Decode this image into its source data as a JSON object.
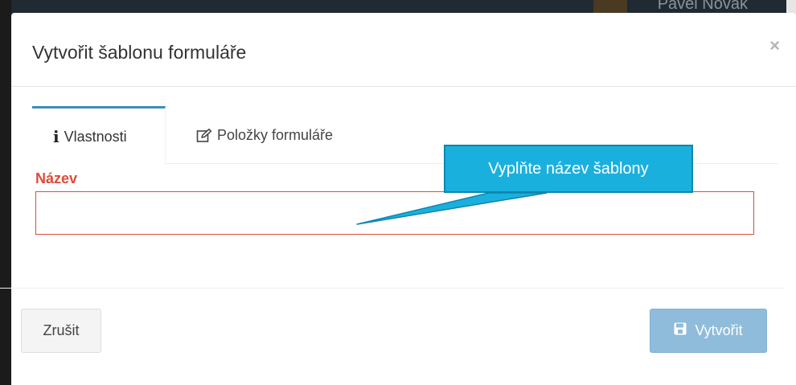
{
  "backdrop": {
    "user_name": "Pavel Novák"
  },
  "modal": {
    "title": "Vytvořit šablonu formuláře",
    "close_label": "×"
  },
  "tabs": [
    {
      "label": "Vlastnosti",
      "icon": "info-icon",
      "active": true
    },
    {
      "label": "Položky formuláře",
      "icon": "edit-icon",
      "active": false
    }
  ],
  "form": {
    "name_label": "Název",
    "name_value": "",
    "error_color": "#dd4b39"
  },
  "footer": {
    "cancel_label": "Zrušit",
    "create_label": "Vytvořit",
    "create_icon": "save-icon",
    "create_color": "#8fbcdb"
  },
  "annotation": {
    "text": "Vyplňte název šablony",
    "color": "#1ab0de"
  },
  "accent_color": "#3c8dbc"
}
